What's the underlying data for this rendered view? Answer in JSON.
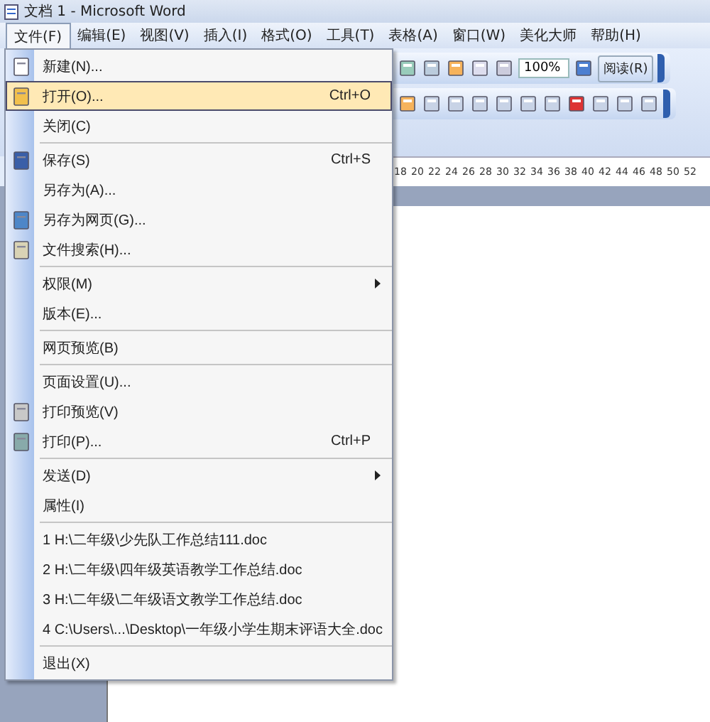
{
  "window": {
    "title": "文档 1 - Microsoft Word"
  },
  "menu_bar": [
    {
      "label": "文件(F)",
      "selected": true
    },
    {
      "label": "编辑(E)",
      "selected": false
    },
    {
      "label": "视图(V)",
      "selected": false
    },
    {
      "label": "插入(I)",
      "selected": false
    },
    {
      "label": "格式(O)",
      "selected": false
    },
    {
      "label": "工具(T)",
      "selected": false
    },
    {
      "label": "表格(A)",
      "selected": false
    },
    {
      "label": "窗口(W)",
      "selected": false
    },
    {
      "label": "美化大师",
      "selected": false
    },
    {
      "label": "帮助(H)",
      "selected": false
    }
  ],
  "toolbar": {
    "zoom": "100%",
    "read_button": "阅读(R)"
  },
  "ruler": [
    "18",
    "20",
    "22",
    "24",
    "26",
    "28",
    "30",
    "32",
    "34",
    "36",
    "38",
    "40",
    "42",
    "44",
    "46",
    "48",
    "50",
    "52"
  ],
  "file_menu": [
    {
      "label": "新建(N)...",
      "kind": "item",
      "icon": true,
      "separator_before": false,
      "selected": false
    },
    {
      "label": "打开(O)...",
      "shortcut": "Ctrl+O",
      "kind": "item",
      "icon": true,
      "separator_before": false,
      "selected": true
    },
    {
      "label": "关闭(C)",
      "kind": "item",
      "icon": false,
      "separator_before": false,
      "selected": false
    },
    {
      "label": "保存(S)",
      "shortcut": "Ctrl+S",
      "kind": "item",
      "icon": true,
      "separator_before": true,
      "selected": false
    },
    {
      "label": "另存为(A)...",
      "kind": "item",
      "icon": false,
      "separator_before": false,
      "selected": false
    },
    {
      "label": "另存为网页(G)...",
      "kind": "item",
      "icon": true,
      "separator_before": false,
      "selected": false
    },
    {
      "label": "文件搜索(H)...",
      "kind": "item",
      "icon": true,
      "separator_before": false,
      "selected": false
    },
    {
      "label": "权限(M)",
      "kind": "submenu",
      "icon": false,
      "separator_before": true,
      "selected": false
    },
    {
      "label": "版本(E)...",
      "kind": "item",
      "icon": false,
      "separator_before": false,
      "selected": false
    },
    {
      "label": "网页预览(B)",
      "kind": "item",
      "icon": false,
      "separator_before": true,
      "selected": false
    },
    {
      "label": "页面设置(U)...",
      "kind": "item",
      "icon": false,
      "separator_before": true,
      "selected": false
    },
    {
      "label": "打印预览(V)",
      "kind": "item",
      "icon": true,
      "separator_before": false,
      "selected": false
    },
    {
      "label": "打印(P)...",
      "shortcut": "Ctrl+P",
      "kind": "item",
      "icon": true,
      "separator_before": false,
      "selected": false
    },
    {
      "label": "发送(D)",
      "kind": "submenu",
      "icon": false,
      "separator_before": true,
      "selected": false
    },
    {
      "label": "属性(I)",
      "kind": "item",
      "icon": false,
      "separator_before": false,
      "selected": false
    },
    {
      "label": "1 H:\\二年级\\少先队工作总结111.doc",
      "kind": "item",
      "icon": false,
      "separator_before": true,
      "selected": false
    },
    {
      "label": "2 H:\\二年级\\四年级英语教学工作总结.doc",
      "kind": "item",
      "icon": false,
      "separator_before": false,
      "selected": false
    },
    {
      "label": "3 H:\\二年级\\二年级语文教学工作总结.doc",
      "kind": "item",
      "icon": false,
      "separator_before": false,
      "selected": false
    },
    {
      "label": "4 C:\\Users\\...\\Desktop\\一年级小学生期末评语大全.doc",
      "kind": "item",
      "icon": false,
      "separator_before": false,
      "selected": false
    },
    {
      "label": "退出(X)",
      "kind": "item",
      "icon": false,
      "separator_before": true,
      "selected": false
    }
  ]
}
